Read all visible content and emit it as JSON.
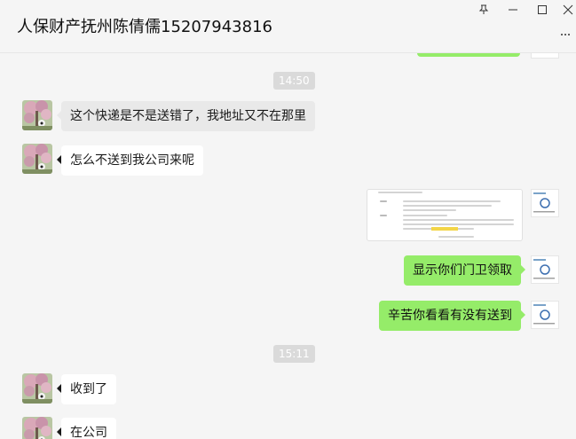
{
  "window": {
    "title": "人保财产抚州陈倩儒15207943816",
    "controls": {
      "pin": "⚲",
      "minimize": "—",
      "maximize": "☐",
      "close": "✕"
    }
  },
  "messages": {
    "time1": "14:50",
    "in1": "这个快递是不是送错了，我地址又不在那里",
    "in2": "怎么不送到我公司来呢",
    "out1": "显示你们门卫领取",
    "out2": "辛苦你看看有没有送到",
    "time2": "15:11",
    "in3": "收到了",
    "in4": "在公司"
  },
  "colors": {
    "outgoing_bubble": "#95ec69",
    "incoming_bubble": "#ffffff",
    "background": "#f5f5f5"
  }
}
